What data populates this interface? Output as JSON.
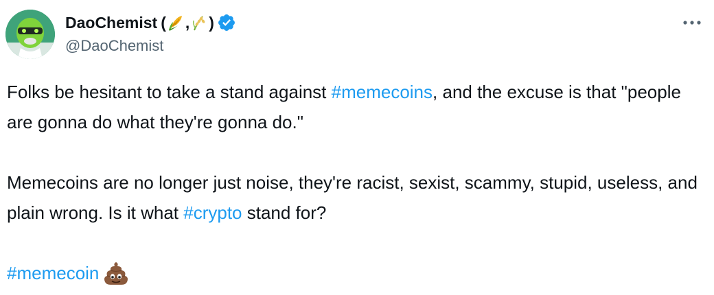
{
  "author": {
    "display_name": "DaoChemist",
    "name_suffix_open": "(",
    "name_suffix_sep": ",",
    "name_suffix_close": ")",
    "handle": "@DaoChemist"
  },
  "tweet": {
    "p1_a": "Folks be hesitant to take a stand against ",
    "p1_tag": "#memecoins",
    "p1_b": ", and the excuse is that \"people are gonna do what they're gonna do.\"",
    "p2_a": "Memecoins are no longer just noise, they're racist, sexist, scammy, stupid, useless, and plain wrong. Is it what ",
    "p2_tag": "#crypto",
    "p2_b": " stand for?",
    "p3_tag": "#memecoin"
  },
  "colors": {
    "hashtag": "#1d9bf0",
    "verified": "#1d9bf0",
    "handle": "#536471"
  },
  "icons": [
    "corn-emoji-icon",
    "rice-emoji-icon",
    "verified-badge-icon",
    "more-options-icon",
    "poo-emoji-icon"
  ]
}
